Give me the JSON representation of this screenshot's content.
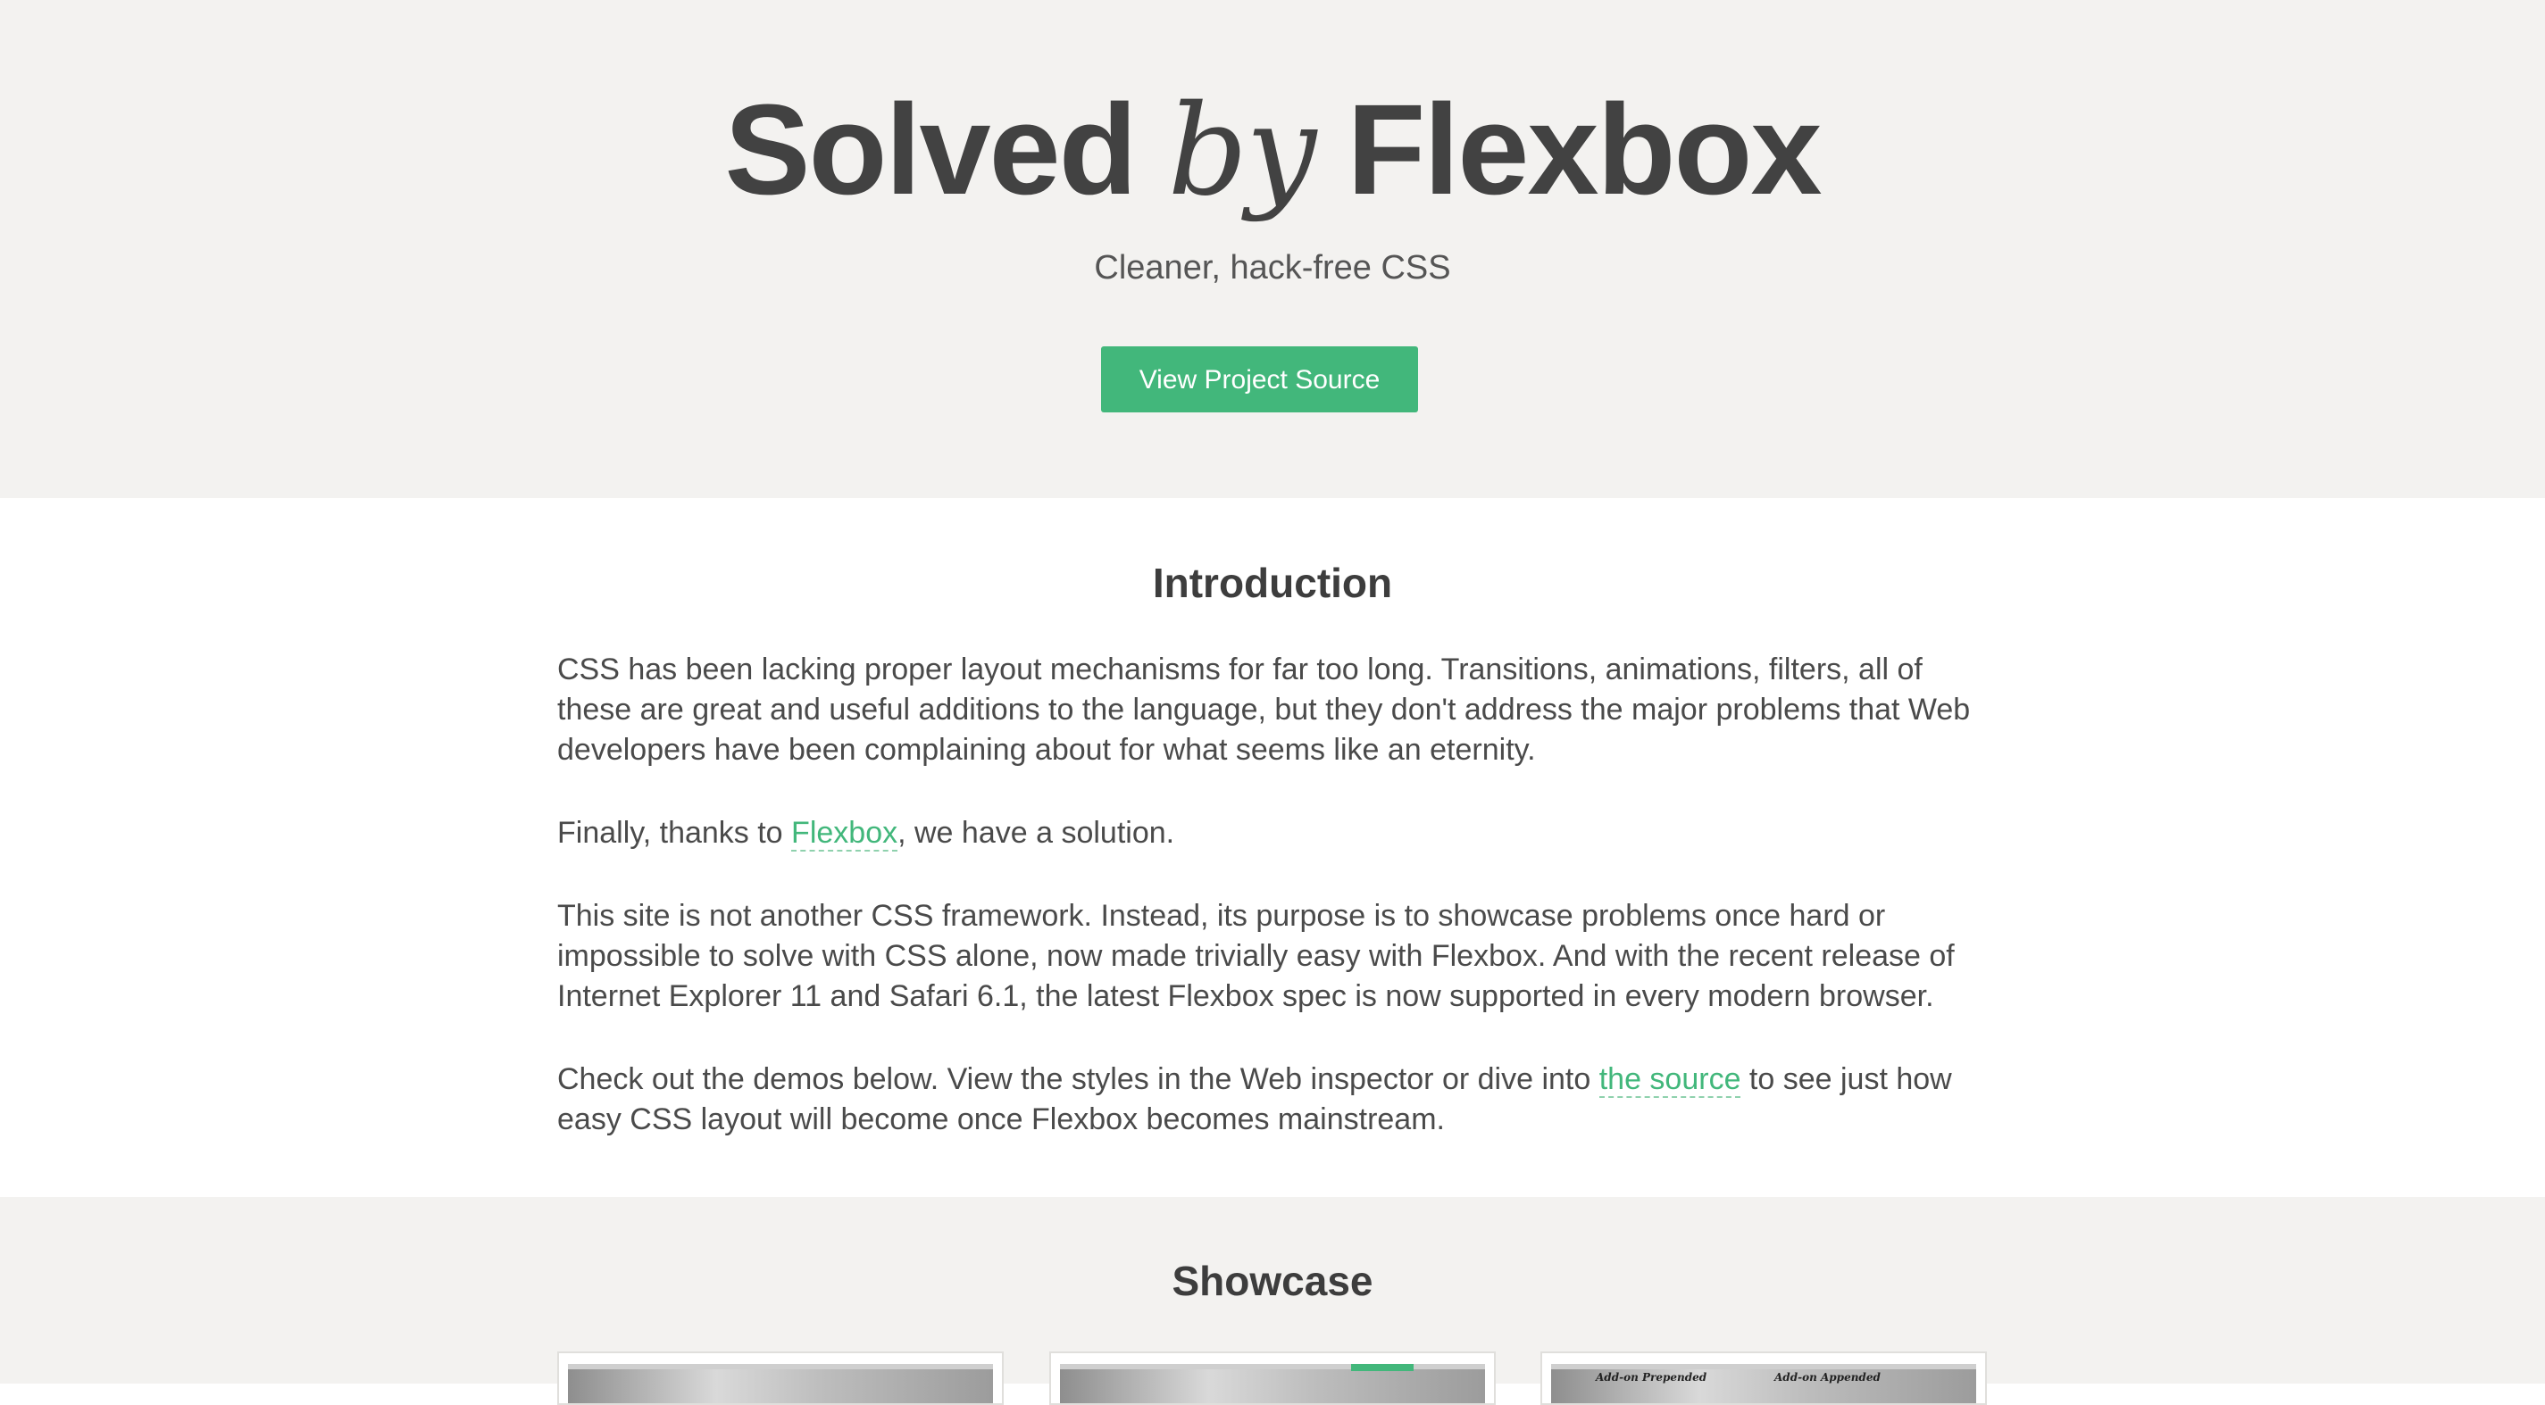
{
  "hero": {
    "title_part1": "Solved",
    "title_by": "by",
    "title_part2": "Flexbox",
    "subtitle": "Cleaner, hack-free CSS",
    "cta_label": "View Project Source"
  },
  "intro": {
    "heading": "Introduction",
    "p1": "CSS has been lacking proper layout mechanisms for far too long. Transitions, animations, filters, all of these are great and useful additions to the language, but they don't address the major problems that Web developers have been complaining about for what seems like an eternity.",
    "p2_before": "Finally, thanks to ",
    "p2_link": "Flexbox",
    "p2_after": ", we have a solution.",
    "p3": "This site is not another CSS framework. Instead, its purpose is to showcase problems once hard or impossible to solve with CSS alone, now made trivially easy with Flexbox. And with the recent release of Internet Explorer 11 and Safari 6.1, the latest Flexbox spec is now supported in every modern browser.",
    "p4_before": "Check out the demos below. View the styles in the Web inspector or dive into ",
    "p4_link": "the source",
    "p4_after": " to see just how easy CSS layout will become once Flexbox becomes mainstream."
  },
  "showcase": {
    "heading": "Showcase",
    "card3_caption_left": "Add-on Prepended",
    "card3_caption_right": "Add-on Appended"
  },
  "colors": {
    "accent": "#42b77b",
    "hero_bg": "#f3f2f0",
    "text": "#444444"
  }
}
